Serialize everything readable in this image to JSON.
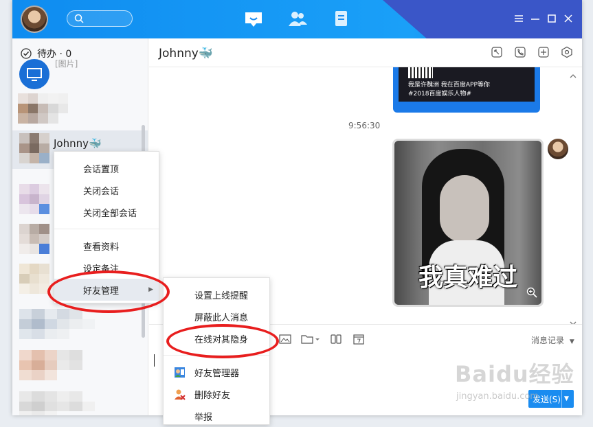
{
  "window": {
    "accent_color": "#1aa0f8"
  },
  "header": {
    "search_placeholder": "",
    "nav_icons": [
      "message-icon",
      "contacts-icon",
      "notes-icon"
    ],
    "window_controls": [
      "menu-icon",
      "minimize-icon",
      "maximize-icon",
      "close-icon"
    ]
  },
  "sidebar": {
    "todo_label": "待办 · 0",
    "conversations": [
      {
        "name": "",
        "preview": "[图片]"
      },
      {
        "name": "",
        "preview": ""
      },
      {
        "name": "Johnny🐳",
        "preview": ""
      }
    ]
  },
  "chat": {
    "title": "Johnny🐳",
    "header_icons": [
      "screenshot-icon",
      "call-icon",
      "add-member-icon",
      "settings-icon"
    ],
    "qr_card": {
      "line1": "我是许魏洲 我在百度APP等你",
      "line2": "#2018百度娱乐人物#"
    },
    "timestamp": "9:56:30",
    "sticker_caption": "我真难过",
    "history_label": "消息记录",
    "send_label": "发送(S)"
  },
  "context_menu": {
    "items": [
      "会话置顶",
      "关闭会话",
      "关闭全部会话",
      "查看资料",
      "设定备注",
      "好友管理"
    ]
  },
  "submenu": {
    "items": [
      "设置上线提醒",
      "屏蔽此人消息",
      "在线对其隐身",
      "好友管理器",
      "删除好友",
      "举报"
    ]
  },
  "watermark": {
    "brand": "Baidu经验",
    "url": "jingyan.baidu.com"
  },
  "colors": {
    "highlight_ellipse": "#e81e1e",
    "send_button": "#1a8cf0"
  }
}
